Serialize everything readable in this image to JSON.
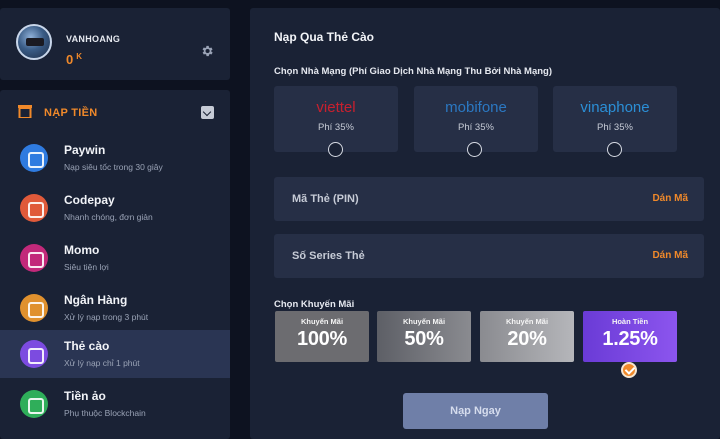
{
  "user": {
    "name": "VANHOANG",
    "balance": "0",
    "balance_unit": "K"
  },
  "menu": {
    "title": "NẠP TIỀN",
    "items": [
      {
        "name": "Paywin",
        "desc": "Nạp siêu tốc trong 30 giây",
        "color": "#2f7be0"
      },
      {
        "name": "Codepay",
        "desc": "Nhanh chóng, đơn giản",
        "color": "#e05a3a"
      },
      {
        "name": "Momo",
        "desc": "Siêu tiện lợi",
        "color": "#c2297a"
      },
      {
        "name": "Ngân Hàng",
        "desc": "Xử lý nạp trong 3 phút",
        "color": "#e0912e"
      },
      {
        "name": "Thẻ cào",
        "desc": "Xử lý nạp chỉ 1 phút",
        "color": "#7c4be0",
        "active": true
      },
      {
        "name": "Tiền ảo",
        "desc": "Phụ thuộc Blockchain",
        "color": "#2fae5a"
      }
    ]
  },
  "panel": {
    "title": "Nạp Qua Thẻ Cào",
    "network_label": "Chọn Nhà Mạng (Phí Giao Dịch Nhà Mạng Thu Bởi Nhà Mạng)",
    "networks": [
      {
        "logo": "viettel",
        "fee": "Phí 35%",
        "color": "#c8202e"
      },
      {
        "logo": "mobifone",
        "fee": "Phí 35%",
        "color": "#2b78c2"
      },
      {
        "logo": "vinaphone",
        "fee": "Phí 35%",
        "color": "#2b8fd6"
      }
    ],
    "pin_label": "Mã Thẻ (PIN)",
    "series_label": "Số Series Thẻ",
    "paste_label": "Dán Mã",
    "promo_label": "Chọn Khuyến Mãi",
    "promos": [
      {
        "label": "Khuyến Mãi",
        "value": "100%"
      },
      {
        "label": "Khuyến Mãi",
        "value": "50%"
      },
      {
        "label": "Khuyến Mãi",
        "value": "20%"
      },
      {
        "label": "Hoàn Tiền",
        "value": "1.25%",
        "selected": true
      }
    ],
    "submit_label": "Nạp Ngay"
  }
}
